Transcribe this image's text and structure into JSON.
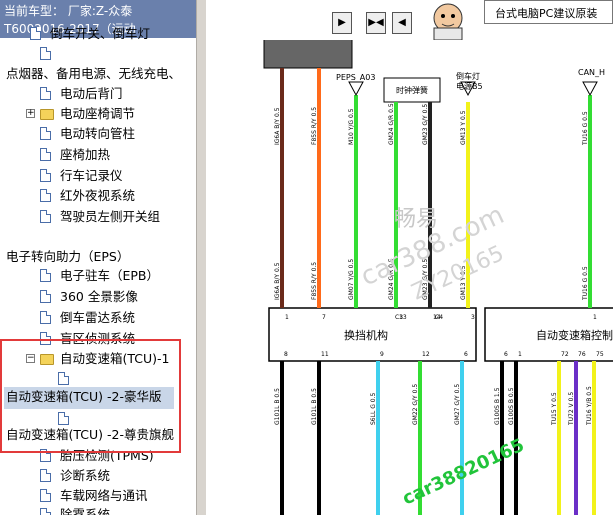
{
  "vehicle_bar": {
    "line1": "当前车型： 厂家:Z-众泰T6002016-2017（运动",
    "line2": "版）"
  },
  "tree": [
    {
      "label": "倒车开关、倒车灯",
      "type": "doc"
    },
    {
      "label": "",
      "type": "doc"
    },
    {
      "label": "点烟器、备用电源、无线充电、",
      "type": "root"
    },
    {
      "label": "电动后背门",
      "type": "doc"
    },
    {
      "label": "电动座椅调节",
      "type": "folder"
    },
    {
      "label": "电动转向管柱",
      "type": "doc"
    },
    {
      "label": "座椅加热",
      "type": "doc"
    },
    {
      "label": "行车记录仪",
      "type": "doc"
    },
    {
      "label": "红外夜视系统",
      "type": "doc"
    },
    {
      "label": "驾驶员左侧开关组",
      "type": "doc"
    },
    {
      "label": "电子转向助力（EPS）",
      "type": "root"
    },
    {
      "label": "电子驻车（EPB）",
      "type": "doc"
    },
    {
      "label": "360 全景影像",
      "type": "doc"
    },
    {
      "label": "倒车雷达系统",
      "type": "doc"
    },
    {
      "label": "盲区侦测系统",
      "type": "doc"
    },
    {
      "label": "自动变速箱(TCU)-1",
      "type": "folder"
    },
    {
      "label": "",
      "type": "doc"
    },
    {
      "label": "自动变速箱(TCU) -2-豪华版",
      "type": "selected"
    },
    {
      "label": "",
      "type": "doc"
    },
    {
      "label": "自动变速箱(TCU) -2-尊贵旗舰",
      "type": "root"
    },
    {
      "label": "胎压检测(TPMS)",
      "type": "doc"
    },
    {
      "label": "诊断系统",
      "type": "doc"
    },
    {
      "label": "车载网络与通讯",
      "type": "doc"
    },
    {
      "label": "除雾系统",
      "type": "doc"
    }
  ],
  "toolbar": {
    "btn1": "▶",
    "btn2": "▶◀",
    "btn3": "◀",
    "btn4": "▶"
  },
  "banner": "台式电脑PC建议原装",
  "diagram": {
    "connectors": {
      "peps": "PEPS_A03",
      "clock": "时钟弹簧",
      "tail": "倒车灯\n电源B5",
      "can": "CAN_H"
    },
    "modules": {
      "shift": "换挡机构",
      "tcu": "自动变速箱控制"
    },
    "top_pins": [
      "1",
      "7",
      "C3",
      "C4",
      "13",
      "14",
      "3",
      "1"
    ],
    "bottom_pins": [
      "8",
      "11",
      "9",
      "12",
      "6",
      "6",
      "1",
      "72",
      "76",
      "75"
    ],
    "wire_labels_top": [
      "IG6A B/Y 0.5",
      "F85S R/Y 0.5",
      "M10 Y/G 0.5",
      "GM24 G/R 0.5",
      "GM23 G/Y 0.5",
      "GM13 Y 0.5",
      "TU16 G 0.5"
    ],
    "wire_labels_mid": [
      "IG6A B/Y 0.5",
      "F85S R/Y 0.5",
      "GM07 Y/G 0.5",
      "GM24 G/R 0.5",
      "GM23 G/Y 0.5",
      "GM13 Y 0.5",
      "TU16 G 0.5"
    ],
    "wire_labels_bottom": [
      "G101L B 0.5",
      "G101L B 0.5",
      "S6LL G 0.5",
      "GM22 G/Y 0.5",
      "GM27 G/Y 0.5",
      "G100S B 1.5",
      "G100S B 0.5",
      "TU15 Y 0.5",
      "TU72 V 0.5",
      "TU16 Y/B 0.5"
    ]
  },
  "watermarks": {
    "site": "汽车维修平台",
    "brand": "畅易",
    "domain": "car388.com",
    "code": "ZY20165",
    "bottom": "car38820165"
  },
  "colors": {
    "vehicle_bar_bg": "#6a80ac",
    "selection": "#c9d6e8",
    "red_box": "#e23a3a",
    "wire_green": "#33dd33",
    "wire_orange": "#ff6a1a",
    "wire_brown": "#6b2a1a",
    "wire_yellow": "#f2f21a",
    "wire_cyan": "#3fd0ee"
  }
}
